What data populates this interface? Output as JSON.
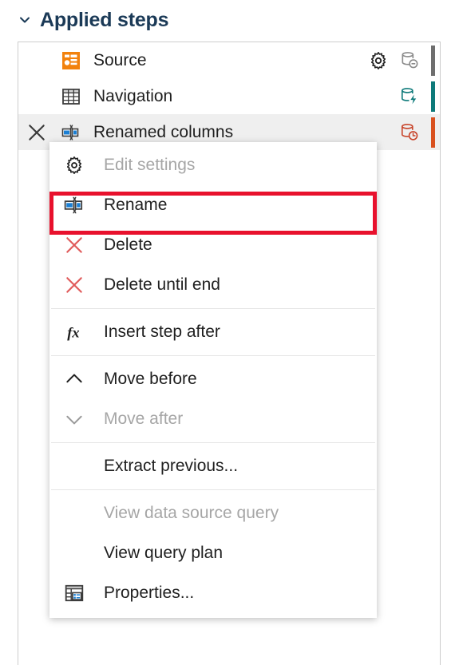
{
  "header": {
    "title": "Applied steps",
    "collapse_icon": "chevron-down-icon"
  },
  "steps": [
    {
      "label": "Source",
      "icon": "source-step-icon",
      "selected": false,
      "has_gear": true,
      "gear_icon": "gear-icon",
      "db_icon": "database-disabled-icon",
      "db_color": "#8a8a8a",
      "status_color": "#6e6e6e"
    },
    {
      "label": "Navigation",
      "icon": "table-step-icon",
      "selected": false,
      "has_gear": false,
      "gear_icon": "",
      "db_icon": "database-folding-icon",
      "db_color": "#0e7a7a",
      "status_color": "#0e7a7a"
    },
    {
      "label": "Renamed columns",
      "icon": "rename-step-icon",
      "selected": true,
      "has_gear": false,
      "gear_icon": "",
      "db_icon": "database-pending-icon",
      "db_color": "#c8442a",
      "status_color": "#d9511f",
      "delete_icon": "close-icon"
    }
  ],
  "context_menu": {
    "items": [
      {
        "label": "Edit settings",
        "icon": "gear-icon",
        "disabled": true,
        "has_icon": true
      },
      {
        "label": "Rename",
        "icon": "rename-icon",
        "disabled": false,
        "has_icon": true,
        "highlighted": true
      },
      {
        "label": "Delete",
        "icon": "delete-x-icon",
        "disabled": false,
        "has_icon": true
      },
      {
        "label": "Delete until end",
        "icon": "delete-x-icon",
        "disabled": false,
        "has_icon": true
      },
      {
        "separator_before": true,
        "label": "Insert step after",
        "icon": "fx-icon",
        "disabled": false,
        "has_icon": true
      },
      {
        "separator_before": true,
        "label": "Move before",
        "icon": "chevron-up-icon",
        "disabled": false,
        "has_icon": true
      },
      {
        "label": "Move after",
        "icon": "chevron-down-icon",
        "disabled": true,
        "has_icon": true
      },
      {
        "separator_before": true,
        "label": "Extract previous...",
        "icon": "",
        "disabled": false,
        "has_icon": false
      },
      {
        "separator_before": true,
        "label": "View data source query",
        "icon": "",
        "disabled": true,
        "has_icon": false
      },
      {
        "label": "View query plan",
        "icon": "",
        "disabled": false,
        "has_icon": false
      },
      {
        "label": "Properties...",
        "icon": "properties-icon",
        "disabled": false,
        "has_icon": true
      }
    ]
  },
  "colors": {
    "highlight_red": "#e8112d",
    "title_navy": "#1b3a57",
    "source_orange": "#f2820d",
    "rename_blue": "#1a7fd4",
    "disabled_gray": "#a6a6a6"
  }
}
